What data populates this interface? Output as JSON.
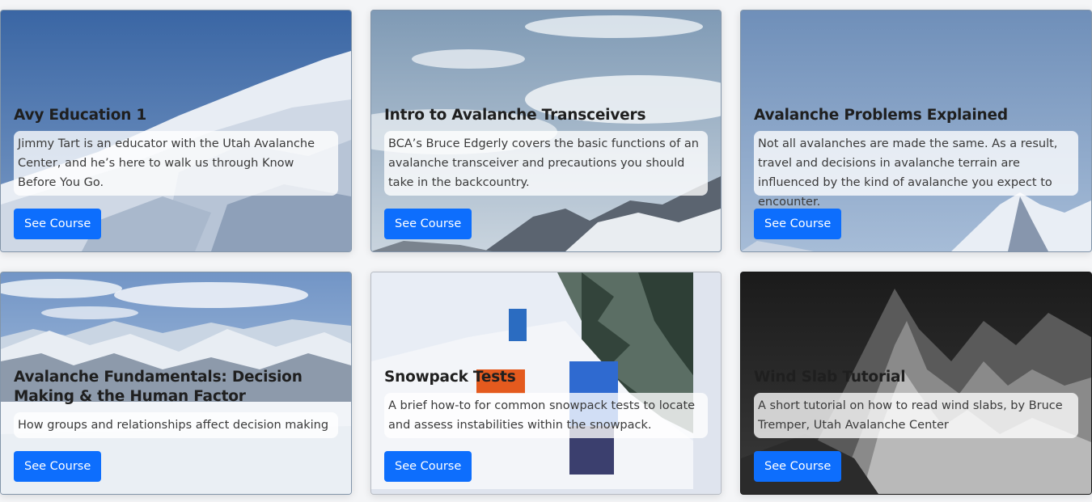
{
  "cards": [
    {
      "title": "Avy Education 1",
      "description": "Jimmy Tart is an educator with the Utah Avalanche Center, and he’s here to walk us through Know Before You Go.",
      "button_label": "See Course",
      "image": "snowy-ridge-blue-sky"
    },
    {
      "title": "Intro to Avalanche Transceivers",
      "description": "BCA’s Bruce Edgerly covers the basic functions of an avalanche transceiver and precautions you should take in the backcountry.",
      "button_label": "See Course",
      "image": "cloudy-sky-rocky-peaks"
    },
    {
      "title": "Avalanche Problems Explained",
      "description": "Not all avalanches are made the same. As a result, travel and decisions in avalanche terrain are influenced by the kind of avalanche you expect to encounter.",
      "button_label": "See Course",
      "image": "blue-sky-snow-peak"
    },
    {
      "title": "Avalanche Fundamentals: Decision Making & the Human Factor",
      "description": "How groups and relationships affect decision making",
      "button_label": "See Course",
      "image": "mountain-range-valley"
    },
    {
      "title": "Snowpack Tests",
      "description": "A brief how-to for common snowpack tests to locate and assess instabilities within the snowpack.",
      "button_label": "See Course",
      "image": "skiers-digging-snowpit"
    },
    {
      "title": "Wind Slab Tutorial",
      "description": "A short tutorial on how to read wind slabs, by Bruce Tremper, Utah Avalanche Center",
      "button_label": "See Course",
      "image": "black-white-peaks"
    }
  ]
}
